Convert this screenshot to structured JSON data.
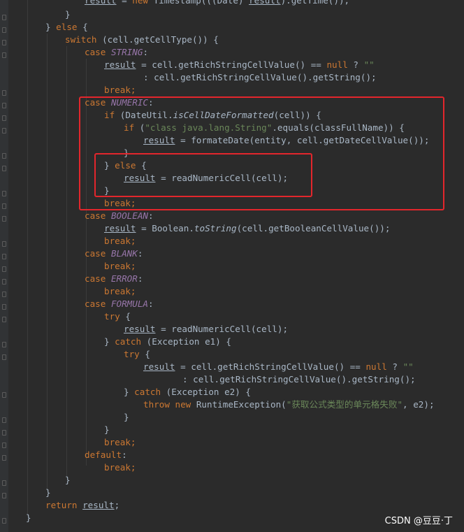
{
  "code": {
    "l0a": "result",
    "l0b": " = ",
    "l0c": "new",
    "l0d": " Timestamp(((Date) ",
    "l0e": "result",
    "l0f": ").getTime());",
    "l1": "}",
    "l2a": "} ",
    "l2b": "else",
    "l2c": " {",
    "l3a": "switch",
    "l3b": " (cell.getCellType()) {",
    "l4a": "case",
    "l4b": " ",
    "l4c": "STRING",
    "l4d": ":",
    "l5a": "result",
    "l5b": " = cell.getRichStringCellValue() == ",
    "l5c": "null",
    "l5d": " ? ",
    "l5e": "\"\"",
    "l6": ": cell.getRichStringCellValue().getString();",
    "l7": "break;",
    "l8a": "case",
    "l8b": " ",
    "l8c": "NUMERIC",
    "l8d": ":",
    "l9a": "if",
    "l9b": " (DateUtil.",
    "l9c": "isCellDateFormatted",
    "l9d": "(cell)) {",
    "l10a": "if",
    "l10b": " (",
    "l10c": "\"class java.lang.String\"",
    "l10d": ".equals(classFullName)) {",
    "l11a": "result",
    "l11b": " = formateDate(entity, cell.getDateCellValue());",
    "l12": "}",
    "l13a": "} ",
    "l13b": "else",
    "l13c": " {",
    "l14a": "result",
    "l14b": " = readNumericCell(cell);",
    "l15": "}",
    "l16": "break;",
    "l17a": "case",
    "l17b": " ",
    "l17c": "BOOLEAN",
    "l17d": ":",
    "l18a": "result",
    "l18b": " = Boolean.",
    "l18c": "toString",
    "l18d": "(cell.getBooleanCellValue());",
    "l19": "break;",
    "l20a": "case",
    "l20b": " ",
    "l20c": "BLANK",
    "l20d": ":",
    "l21": "break;",
    "l22a": "case",
    "l22b": " ",
    "l22c": "ERROR",
    "l22d": ":",
    "l23": "break;",
    "l24a": "case",
    "l24b": " ",
    "l24c": "FORMULA",
    "l24d": ":",
    "l25a": "try",
    "l25b": " {",
    "l26a": "result",
    "l26b": " = readNumericCell(cell);",
    "l27a": "} ",
    "l27b": "catch",
    "l27c": " (Exception e1) {",
    "l28a": "try",
    "l28b": " {",
    "l29a": "result",
    "l29b": " = cell.getRichStringCellValue() == ",
    "l29c": "null",
    "l29d": " ? ",
    "l29e": "\"\"",
    "l30": ": cell.getRichStringCellValue().getString();",
    "l31a": "} ",
    "l31b": "catch",
    "l31c": " (Exception e2) {",
    "l32a": "throw new",
    "l32b": " RuntimeException(",
    "l32c": "\"获取公式类型的单元格失败\"",
    "l32d": ", e2);",
    "l33": "}",
    "l34": "}",
    "l35": "break;",
    "l36a": "default",
    "l36b": ":",
    "l37": "break;",
    "l38": "}",
    "l39": "}",
    "l40a": "return",
    "l40b": " ",
    "l40c": "result",
    "l40d": ";",
    "l41": "}"
  },
  "watermark": "CSDN @豆豆·丁",
  "colors": {
    "background": "#2b2b2b",
    "keyword": "#cc7832",
    "constant": "#9876aa",
    "string": "#6a8759",
    "text": "#a9b7c6",
    "highlight": "#e3262c"
  }
}
